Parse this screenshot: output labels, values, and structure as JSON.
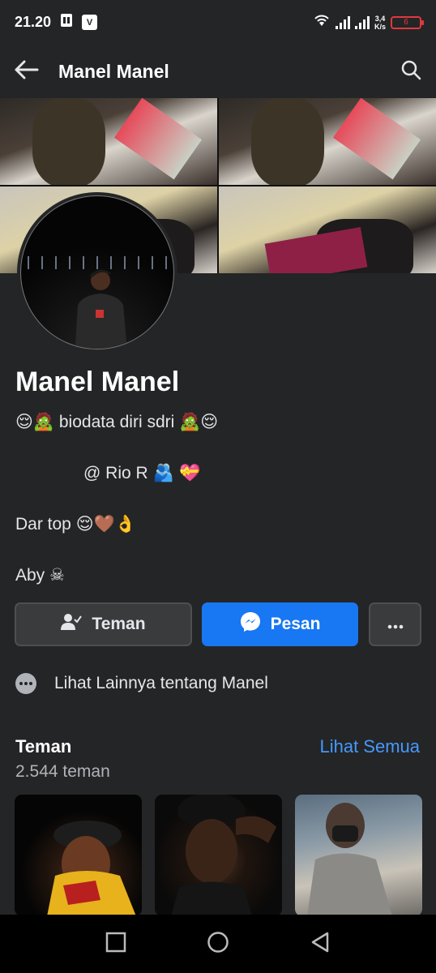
{
  "status_bar": {
    "time": "21.20",
    "app_badge": "V",
    "speed_top": "3,4",
    "speed_unit": "K/s",
    "battery": "6"
  },
  "header": {
    "title": "Manel Manel"
  },
  "profile": {
    "name": "Manel Manel",
    "bio": [
      {
        "prefix": "😌🧟",
        "text": " biodata diri sdri ",
        "suffix": "🧟😌"
      },
      {
        "prefix": "",
        "text": "@ Rio R ",
        "suffix": "🫂 💝"
      },
      {
        "prefix": "",
        "text": "Dar top  ",
        "suffix": "😌🤎👌"
      },
      {
        "prefix": "",
        "text": "Aby ",
        "suffix": "☠"
      }
    ]
  },
  "actions": {
    "friend_label": "Teman",
    "message_label": "Pesan"
  },
  "see_more": {
    "label": "Lihat Lainnya tentang Manel"
  },
  "friends": {
    "title": "Teman",
    "see_all": "Lihat Semua",
    "count": "2.544 teman"
  },
  "colors": {
    "background": "#242526",
    "accent": "#1877f2",
    "link": "#4599ff",
    "battery_low": "#e0383e"
  }
}
